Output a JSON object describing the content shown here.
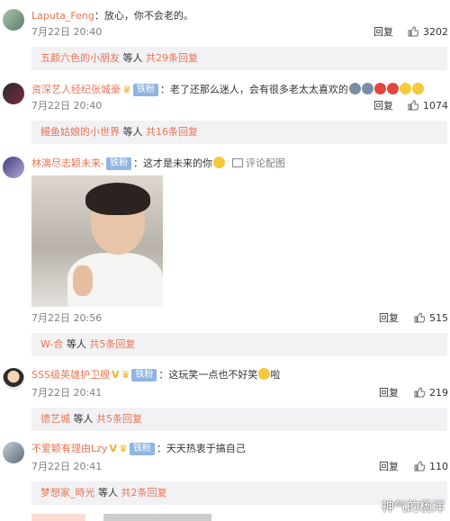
{
  "comments": [
    {
      "user": "Laputa_Feng",
      "text": "：放心，你不会老的。",
      "time": "7月22日 20:40",
      "reply": "回复",
      "likes": "3202",
      "sub": {
        "name": "五颜六色的小朋友",
        "text": " 等人 ",
        "count": "共29条回复"
      }
    },
    {
      "user": "资深艺人经纪张城豪",
      "badge": "铁粉",
      "text": "：老了还那么迷人，会有很多老太太喜欢的",
      "time": "7月22日 20:40",
      "reply": "回复",
      "likes": "1074",
      "sub": {
        "name": "鳗鱼姑娘的小世界",
        "text": " 等人 ",
        "count": "共16条回复"
      }
    },
    {
      "user": "林漓尽志颖未来-",
      "badge": "铁粉",
      "text": "：这才是未来的你",
      "pic_link": "评论配图",
      "time": "7月22日 20:56",
      "reply": "回复",
      "likes": "515",
      "sub": {
        "name": "W-合",
        "text": " 等人 ",
        "count": "共5条回复"
      }
    },
    {
      "user": "SSS级英雄护卫舰",
      "badge": "铁粉",
      "text": "：这玩笑一点也不好笑",
      "text2": "啦",
      "time": "7月22日 20:41",
      "reply": "回复",
      "likes": "219",
      "sub": {
        "name": "德艺城",
        "text": " 等人 ",
        "count": "共5条回复"
      }
    },
    {
      "user": "不爱颖有理由Lzy",
      "badge": "铁粉",
      "text": "：天天热衷于搞自己",
      "time": "7月22日 20:41",
      "reply": "回复",
      "likes": "110",
      "sub": {
        "name": "梦想家_時光",
        "text": " 等人 ",
        "count": "共2条回复"
      }
    }
  ],
  "watermark": "神气的杨洋",
  "colors": {
    "username": "#eb7350",
    "badge": "#8fb5e0",
    "sub_bg": "#f2f2f5"
  }
}
